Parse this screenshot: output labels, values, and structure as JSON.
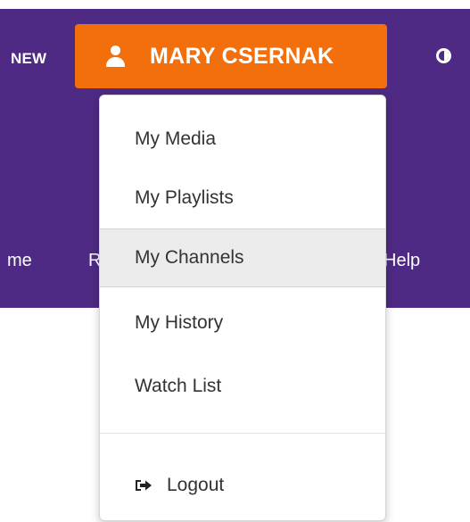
{
  "header": {
    "new_label": "NEW",
    "user_name": "MARY CSERNAK",
    "background_color": "#4e2a84",
    "accent_color": "#f26f0b"
  },
  "nav": {
    "items": [
      {
        "label": "me"
      },
      {
        "label": "R"
      },
      {
        "label": "Help"
      }
    ]
  },
  "dropdown": {
    "items": [
      {
        "label": "My Media"
      },
      {
        "label": "My Playlists"
      },
      {
        "label": "My Channels",
        "hovered": true
      },
      {
        "label": "My History"
      },
      {
        "label": "Watch List"
      }
    ],
    "logout": {
      "label": "Logout",
      "icon": "sign-out-icon"
    }
  },
  "icons": {
    "user": "user-icon",
    "contrast": "contrast-icon"
  }
}
